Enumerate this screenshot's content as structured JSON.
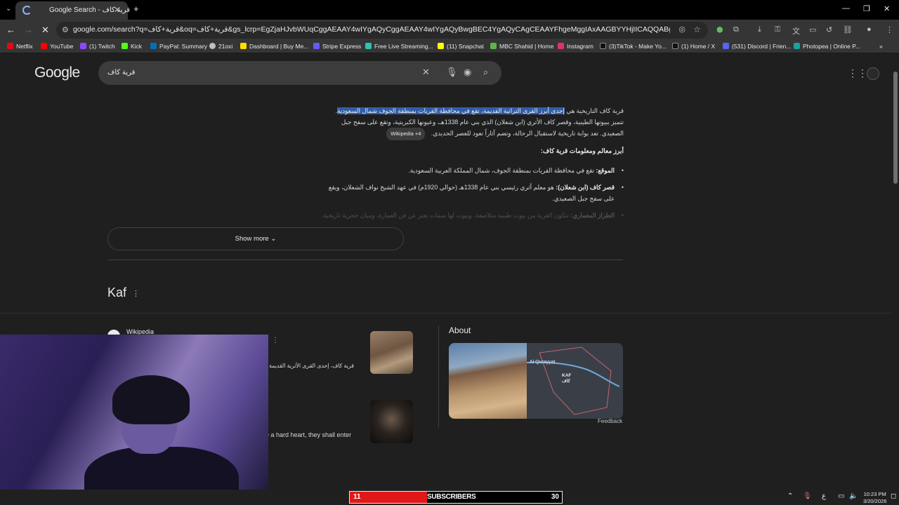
{
  "browser": {
    "tab_title": "Google Search - قرية كاف",
    "url": "google.com/search?q=قرية+كاف&oq=قرية+كاف&gs_lcrp=EgZjaHJvbWUqCggAEAAY4wIYgAQyCggAEAAY4wIYgAQyBwgBEC4YgAQyCAgCEAAYFhgeMggIAxAAGBYYHjIICAQQABgWGB4yCAgFEAAYFhgeMggI...",
    "bookmarks": [
      {
        "label": "Netflix",
        "color": "#e50914"
      },
      {
        "label": "YouTube",
        "color": "#ff0000"
      },
      {
        "label": "(1) Twitch",
        "color": "#9146ff"
      },
      {
        "label": "Kick",
        "color": "#53fc18"
      },
      {
        "label": "PayPal: Summary",
        "color": "#0070ba"
      },
      {
        "label": "21oxi",
        "color": "#bdc1c6"
      },
      {
        "label": "Dashboard | Buy Me...",
        "color": "#ffdd00"
      },
      {
        "label": "Stripe Express",
        "color": "#635bff"
      },
      {
        "label": "Free Live Streaming...",
        "color": "#2bc4b0"
      },
      {
        "label": "(11) Snapchat",
        "color": "#fffc00"
      },
      {
        "label": "MBC Shahid | Home",
        "color": "#5fb548"
      },
      {
        "label": "Instagram",
        "color": "#e1306c"
      },
      {
        "label": "(3)TikTok - Make Yo...",
        "color": "#000000"
      },
      {
        "label": "(1) Home / X",
        "color": "#000000"
      },
      {
        "label": "(531) Discord | Frien...",
        "color": "#5865f2"
      },
      {
        "label": "Photopea | Online P...",
        "color": "#18a497"
      }
    ]
  },
  "search": {
    "query": "قرية كاف"
  },
  "overview": {
    "para_prefix": "قرية كاف التاريخية هي ",
    "para_highlight": "إحدى أبرز القرى التراثية القديمة، تقع في محافظة القريات بمنطقة الجوف شمال السعودية",
    "para_rest": ". تتميز ببيوتها الطينية، وقصر كاف الأثري (ابن شعلان) الذي بني عام 1338هـ، وعيونها الكبريتية، وتقع على سفح جبل الصعيدي. تعد بوابة تاريخية لاستقبال الرحالة، وتضم آثاراً تعود للعصر الحديدي.",
    "wiki_chip": "Wikipedia +4",
    "heading": "أبرز معالم ومعلومات قرية كاف:",
    "bullets": [
      {
        "label": "الموقع:",
        "text": " تقع في محافظة القريات بمنطقة الجوف، شمال المملكة العربية السعودية."
      },
      {
        "label": "قصر كاف (ابن شعلان):",
        "text": " هو معلم أثري رئيسي بني عام 1338هـ (حوالي 1920م) في عهد الشيخ نواف الشعلان، ويقع على سفح جبل الصعيدي."
      },
      {
        "label": "الطراز المعماري:",
        "text": " تتكون القرية من بيوت طينية متلاصقة، وبيوت لها سمات تعبر عن فن العمارة، ومبان حجرية تاريخية."
      }
    ],
    "show_more": "Show more"
  },
  "kaf": {
    "title": "Kaf",
    "source": "Wikipedia",
    "snippet1": "قرية كاف، إحدى القرى الأثرية القديمة",
    "snippet2": "e a hard heart, they shall enter"
  },
  "about": {
    "title": "About",
    "map_label_1": "Al Qurayyat",
    "map_label_2": "KAF",
    "map_label_3": "كاف",
    "feedback": "Feedback"
  },
  "stream": {
    "subs_count": "11",
    "subs_label": "SUBSCRIBERS",
    "subs_goal": "30"
  },
  "taskbar": {
    "time": "10:23 PM",
    "date": "3/20/2026",
    "lang": "ع"
  }
}
